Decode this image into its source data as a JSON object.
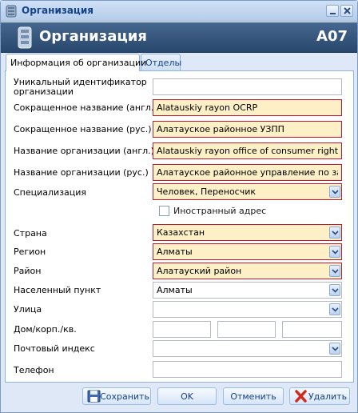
{
  "window": {
    "title": "Организация"
  },
  "header": {
    "title": "Организация",
    "code": "A07"
  },
  "tabs": [
    {
      "label": "Информация об организации",
      "active": true
    },
    {
      "label": "Отделы",
      "active": false
    }
  ],
  "fields": {
    "uid": {
      "label": "Уникальный идентификатор организации",
      "value": ""
    },
    "short_en": {
      "label": "Сокращенное название (англ.)",
      "value": "Alatauskiy rayon OCRP"
    },
    "short_ru": {
      "label": "Сокращенное название (рус.)",
      "value": "Алатауское районное УЗПП"
    },
    "name_en": {
      "label": "Название организации (англ.)",
      "value": "Alatauskiy rayon office of consumer rights prot"
    },
    "name_ru": {
      "label": "Название организации (рус.)",
      "value": "Алатауское районное управление по защите"
    },
    "specialization": {
      "label": "Специализация",
      "value": "Человек, Переносчик"
    },
    "foreign_address": {
      "label": "Иностранный адрес",
      "checked": false
    },
    "country": {
      "label": "Страна",
      "value": "Казахстан"
    },
    "region": {
      "label": "Регион",
      "value": "Алматы"
    },
    "district": {
      "label": "Район",
      "value": "Алатауский район"
    },
    "locality": {
      "label": "Населенный пункт",
      "value": "Алматы"
    },
    "street": {
      "label": "Улица",
      "value": ""
    },
    "house": {
      "label": "Дом/корп./кв.",
      "house": "",
      "building": "",
      "apartment": ""
    },
    "postal": {
      "label": "Почтовый индекс",
      "value": ""
    },
    "phone": {
      "label": "Телефон",
      "value": ""
    }
  },
  "buttons": {
    "save": "Сохранить",
    "ok": "OK",
    "cancel": "Отменить",
    "delete": "Удалить"
  },
  "colors": {
    "required_bg": "#fdf0c7",
    "required_border": "#c5172d",
    "header_bg": "#34557d"
  },
  "icons": {
    "window": "database-icon",
    "header": "database-icon",
    "save": "floppy-disk-icon",
    "delete": "red-x-icon"
  }
}
